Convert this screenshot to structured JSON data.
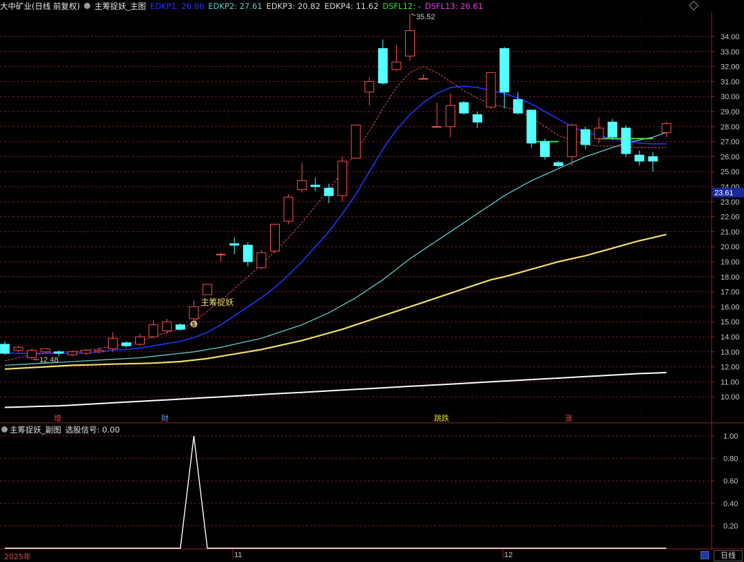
{
  "header": {
    "stock_name": "大中矿业(日线 前复权)",
    "indicator_title": "主筹捉妖_主图",
    "indicators": [
      {
        "label": "EDKP1: 26.86",
        "color": "#2233ff"
      },
      {
        "label": "EDKP2: 27.61",
        "color": "#66cccc"
      },
      {
        "label": "EDKP3: 20.82",
        "color": "#dcdcdc"
      },
      {
        "label": "EDKP4: 11.62",
        "color": "#dcdcdc"
      },
      {
        "label": "DSFL12: -",
        "color": "#44dd44"
      },
      {
        "label": "DSFL13: 26.61",
        "color": "#dd44dd"
      }
    ]
  },
  "sub_header": {
    "title": "主筹捉妖_副图",
    "signal": "选股信号: 0.00"
  },
  "price_axis": {
    "labels": [
      "34.00",
      "33.00",
      "32.00",
      "31.00",
      "30.00",
      "29.00",
      "28.00",
      "27.00",
      "26.00",
      "25.00",
      "24.00",
      "23.00",
      "22.00",
      "21.00",
      "20.00",
      "19.00",
      "18.00",
      "17.00",
      "16.00",
      "15.00",
      "14.00",
      "13.00",
      "12.00",
      "11.00",
      "10.00"
    ],
    "current_price_tag": "23.61"
  },
  "sub_axis": {
    "labels": [
      "1.00",
      "0.80",
      "0.60",
      "0.40",
      "0.20"
    ]
  },
  "annotations": {
    "high_label": "35.52",
    "low_label": "12.48",
    "signal_text": "主筹捉妖",
    "signal_badge": "$",
    "event_markers": [
      {
        "text": "增",
        "color": "#e04848"
      },
      {
        "text": "财",
        "color": "#6a9ad8"
      },
      {
        "text": "跳跌",
        "color": "#d8d838"
      },
      {
        "text": "涨",
        "color": "#e04848"
      }
    ]
  },
  "time_axis": {
    "start_label": "2025年",
    "month_labels": [
      "11",
      "12"
    ]
  },
  "period_tab": "日线",
  "colors": {
    "up": "#ff5050",
    "down": "#54ffff",
    "edkp1": "#2233ff",
    "edkp2": "#66cccc",
    "edkp3": "#f0e070",
    "edkp4": "#ffffff",
    "dsfl12": "#44dd44",
    "dsfl13": "#dd44dd",
    "grid": "#7a1a1a",
    "axis_text": "#c8c8c8"
  },
  "candles": [
    {
      "o": 13.5,
      "c": 12.9,
      "h": 13.7,
      "l": 12.8
    },
    {
      "o": 13.1,
      "c": 13.3,
      "h": 13.4,
      "l": 13.0
    },
    {
      "o": 12.6,
      "c": 13.1,
      "h": 13.2,
      "l": 12.48
    },
    {
      "o": 13.0,
      "c": 13.2,
      "h": 13.2,
      "l": 12.9
    },
    {
      "o": 13.0,
      "c": 12.9,
      "h": 13.1,
      "l": 12.7
    },
    {
      "o": 12.8,
      "c": 13.0,
      "h": 13.1,
      "l": 12.7
    },
    {
      "o": 12.9,
      "c": 13.1,
      "h": 13.2,
      "l": 12.8
    },
    {
      "o": 13.0,
      "c": 13.1,
      "h": 13.3,
      "l": 12.9
    },
    {
      "o": 13.2,
      "c": 13.9,
      "h": 14.3,
      "l": 13.0
    },
    {
      "o": 13.6,
      "c": 13.4,
      "h": 13.7,
      "l": 13.3
    },
    {
      "o": 13.5,
      "c": 14.0,
      "h": 14.2,
      "l": 13.4
    },
    {
      "o": 14.0,
      "c": 14.8,
      "h": 15.1,
      "l": 13.9
    },
    {
      "o": 14.4,
      "c": 15.0,
      "h": 15.2,
      "l": 14.2
    },
    {
      "o": 14.8,
      "c": 14.5,
      "h": 14.9,
      "l": 14.4
    },
    {
      "o": 15.2,
      "c": 16.0,
      "h": 16.4,
      "l": 15.0
    },
    {
      "o": 16.8,
      "c": 17.5,
      "h": 17.5,
      "l": 16.8
    },
    {
      "o": 19.5,
      "c": 19.5,
      "h": 19.6,
      "l": 19.0
    },
    {
      "o": 20.2,
      "c": 20.1,
      "h": 20.6,
      "l": 19.5
    },
    {
      "o": 20.1,
      "c": 19.0,
      "h": 20.3,
      "l": 18.7
    },
    {
      "o": 18.6,
      "c": 19.6,
      "h": 19.8,
      "l": 18.5
    },
    {
      "o": 19.7,
      "c": 21.5,
      "h": 21.5,
      "l": 19.6
    },
    {
      "o": 21.7,
      "c": 23.3,
      "h": 23.5,
      "l": 21.5
    },
    {
      "o": 23.8,
      "c": 24.4,
      "h": 25.6,
      "l": 23.6
    },
    {
      "o": 24.1,
      "c": 24.0,
      "h": 24.6,
      "l": 23.7
    },
    {
      "o": 23.9,
      "c": 23.4,
      "h": 24.2,
      "l": 22.9
    },
    {
      "o": 23.4,
      "c": 25.7,
      "h": 26.0,
      "l": 23.0
    },
    {
      "o": 25.9,
      "c": 28.1,
      "h": 28.1,
      "l": 25.9
    },
    {
      "o": 30.3,
      "c": 31.0,
      "h": 31.3,
      "l": 29.4
    },
    {
      "o": 33.2,
      "c": 30.9,
      "h": 33.8,
      "l": 30.8
    },
    {
      "o": 31.8,
      "c": 32.3,
      "h": 33.4,
      "l": 31.7
    },
    {
      "o": 32.7,
      "c": 34.4,
      "h": 35.52,
      "l": 32.4
    },
    {
      "o": 31.2,
      "c": 31.2,
      "h": 31.5,
      "l": 31.2
    },
    {
      "o": 28.0,
      "c": 28.0,
      "h": 29.6,
      "l": 28.0
    },
    {
      "o": 28.0,
      "c": 29.4,
      "h": 30.2,
      "l": 27.3
    },
    {
      "o": 29.6,
      "c": 28.9,
      "h": 29.7,
      "l": 28.8
    },
    {
      "o": 28.8,
      "c": 28.3,
      "h": 29.0,
      "l": 27.9
    },
    {
      "o": 29.3,
      "c": 31.6,
      "h": 31.6,
      "l": 29.2
    },
    {
      "o": 33.2,
      "c": 30.3,
      "h": 33.3,
      "l": 29.2
    },
    {
      "o": 29.8,
      "c": 28.9,
      "h": 30.3,
      "l": 28.8
    },
    {
      "o": 29.1,
      "c": 26.9,
      "h": 29.1,
      "l": 26.6
    },
    {
      "o": 27.0,
      "c": 26.0,
      "h": 27.2,
      "l": 25.8
    },
    {
      "o": 25.6,
      "c": 25.4,
      "h": 25.7,
      "l": 25.3
    },
    {
      "o": 26.0,
      "c": 28.1,
      "h": 28.2,
      "l": 25.4
    },
    {
      "o": 27.8,
      "c": 26.8,
      "h": 28.0,
      "l": 26.5
    },
    {
      "o": 27.2,
      "c": 27.9,
      "h": 28.6,
      "l": 26.9
    },
    {
      "o": 28.3,
      "c": 27.3,
      "h": 28.5,
      "l": 27.1
    },
    {
      "o": 27.9,
      "c": 26.2,
      "h": 28.1,
      "l": 26.0
    },
    {
      "o": 26.1,
      "c": 25.7,
      "h": 26.4,
      "l": 25.4
    },
    {
      "o": 26.0,
      "c": 25.7,
      "h": 26.3,
      "l": 25.0
    },
    {
      "o": 27.6,
      "c": 28.2,
      "h": 28.3,
      "l": 27.3
    }
  ],
  "lines": {
    "edkp1": [
      12.9,
      12.9,
      12.9,
      12.9,
      12.9,
      12.9,
      12.95,
      13.0,
      13.1,
      13.15,
      13.25,
      13.4,
      13.55,
      13.7,
      13.95,
      14.3,
      14.8,
      15.4,
      16.0,
      16.6,
      17.3,
      18.1,
      19.0,
      20.0,
      21.0,
      22.2,
      23.5,
      25.0,
      26.5,
      27.8,
      28.8,
      29.6,
      30.2,
      30.6,
      30.7,
      30.6,
      30.4,
      30.2,
      29.9,
      29.5,
      29.0,
      28.5,
      28.0,
      27.6,
      27.4,
      27.2,
      27.0,
      26.9,
      26.85,
      26.86
    ],
    "edkp2": [
      12.1,
      12.15,
      12.2,
      12.25,
      12.3,
      12.35,
      12.4,
      12.45,
      12.5,
      12.55,
      12.6,
      12.7,
      12.8,
      12.9,
      13.0,
      13.15,
      13.3,
      13.5,
      13.7,
      13.9,
      14.2,
      14.5,
      14.8,
      15.2,
      15.6,
      16.1,
      16.6,
      17.2,
      17.8,
      18.5,
      19.2,
      19.8,
      20.4,
      21.0,
      21.6,
      22.2,
      22.8,
      23.4,
      23.9,
      24.4,
      24.8,
      25.2,
      25.6,
      26.0,
      26.3,
      26.6,
      26.9,
      27.1,
      27.3,
      27.61
    ],
    "edkp3": [
      11.85,
      11.9,
      11.95,
      12.0,
      12.05,
      12.1,
      12.12,
      12.15,
      12.18,
      12.2,
      12.22,
      12.25,
      12.3,
      12.35,
      12.45,
      12.55,
      12.7,
      12.85,
      13.0,
      13.15,
      13.35,
      13.55,
      13.75,
      14.0,
      14.25,
      14.5,
      14.8,
      15.1,
      15.4,
      15.7,
      16.0,
      16.3,
      16.6,
      16.9,
      17.2,
      17.5,
      17.8,
      18.0,
      18.25,
      18.5,
      18.75,
      19.0,
      19.2,
      19.4,
      19.65,
      19.9,
      20.15,
      20.4,
      20.6,
      20.82
    ],
    "edkp4": [
      9.3,
      9.32,
      9.35,
      9.38,
      9.4,
      9.45,
      9.5,
      9.55,
      9.6,
      9.65,
      9.7,
      9.75,
      9.8,
      9.85,
      9.9,
      9.95,
      10.0,
      10.05,
      10.1,
      10.15,
      10.2,
      10.25,
      10.3,
      10.35,
      10.4,
      10.45,
      10.5,
      10.55,
      10.6,
      10.65,
      10.7,
      10.75,
      10.8,
      10.85,
      10.9,
      10.95,
      11.0,
      11.05,
      11.1,
      11.15,
      11.2,
      11.25,
      11.3,
      11.35,
      11.4,
      11.45,
      11.5,
      11.55,
      11.58,
      11.62
    ],
    "dsfl13": [
      12.4,
      12.6,
      12.8,
      12.9,
      13.0,
      13.0,
      13.1,
      13.2,
      13.4,
      13.5,
      13.7,
      14.0,
      14.3,
      14.5,
      15.0,
      15.7,
      16.4,
      17.2,
      18.0,
      18.8,
      19.7,
      20.6,
      21.6,
      22.7,
      23.8,
      25.0,
      26.3,
      27.7,
      29.2,
      30.6,
      31.6,
      32.0,
      31.6,
      31.0,
      30.4,
      29.9,
      29.5,
      29.3,
      29.1,
      28.6,
      28.0,
      27.4,
      27.1,
      26.8,
      26.7,
      26.7,
      26.65,
      26.6,
      26.6,
      26.61
    ],
    "dsfl12_segments": [
      [
        39,
        41,
        27.0
      ],
      [
        44,
        48,
        27.2
      ]
    ]
  },
  "sub_signal": [
    0,
    0,
    0,
    0,
    0,
    0,
    0,
    0,
    0,
    0,
    0,
    0,
    0,
    0,
    1.0,
    0,
    0,
    0,
    0,
    0,
    0,
    0,
    0,
    0,
    0,
    0,
    0,
    0,
    0,
    0,
    0,
    0,
    0,
    0,
    0,
    0,
    0,
    0,
    0,
    0,
    0,
    0,
    0,
    0,
    0,
    0,
    0,
    0,
    0,
    0
  ]
}
